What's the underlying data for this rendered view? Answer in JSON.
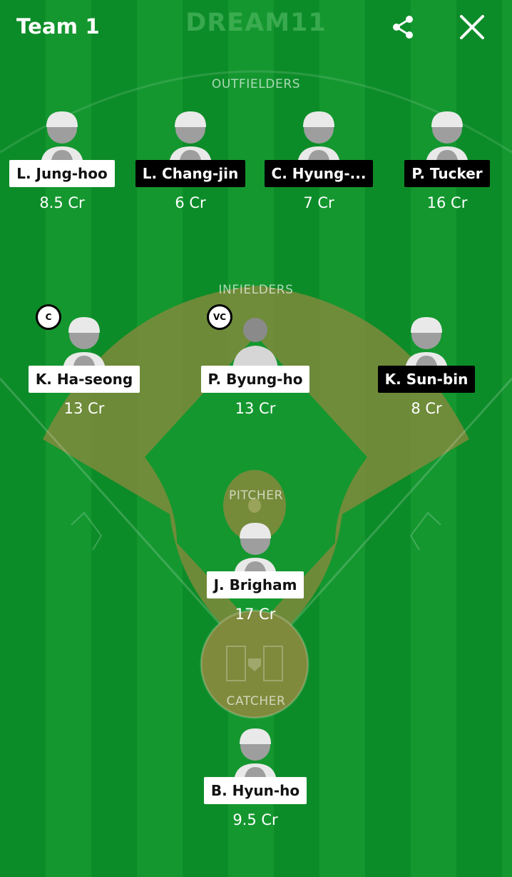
{
  "header": {
    "team_title": "Team 1",
    "brand": "DREAM11",
    "share_icon": "share-icon",
    "close_icon": "close-icon"
  },
  "sections": {
    "outfielders": "OUTFIELDERS",
    "infielders": "INFIELDERS",
    "pitcher": "PITCHER",
    "catcher": "CATCHER"
  },
  "outfielders": [
    {
      "name": "L. Jung-hoo",
      "credit": "8.5 Cr",
      "tag": "light"
    },
    {
      "name": "L. Chang-jin",
      "credit": "6 Cr",
      "tag": "dark"
    },
    {
      "name": "C. Hyung-...",
      "credit": "7 Cr",
      "tag": "dark"
    },
    {
      "name": "P. Tucker",
      "credit": "16 Cr",
      "tag": "dark"
    }
  ],
  "infielders": [
    {
      "name": "K. Ha-seong",
      "credit": "13 Cr",
      "tag": "light",
      "badge": "C"
    },
    {
      "name": "P. Byung-ho",
      "credit": "13 Cr",
      "tag": "light",
      "badge": "VC"
    },
    {
      "name": "K. Sun-bin",
      "credit": "8 Cr",
      "tag": "dark"
    }
  ],
  "pitcher": {
    "name": "J. Brigham",
    "credit": "17 Cr",
    "tag": "light"
  },
  "catcher": {
    "name": "B. Hyun-ho",
    "credit": "9.5 Cr",
    "tag": "light"
  },
  "colors": {
    "grass_dark": "#0c8c28",
    "grass_light": "#14972f",
    "dirt": "#7a8a3a",
    "tag_light_bg": "#ffffff",
    "tag_dark_bg": "#000000"
  }
}
